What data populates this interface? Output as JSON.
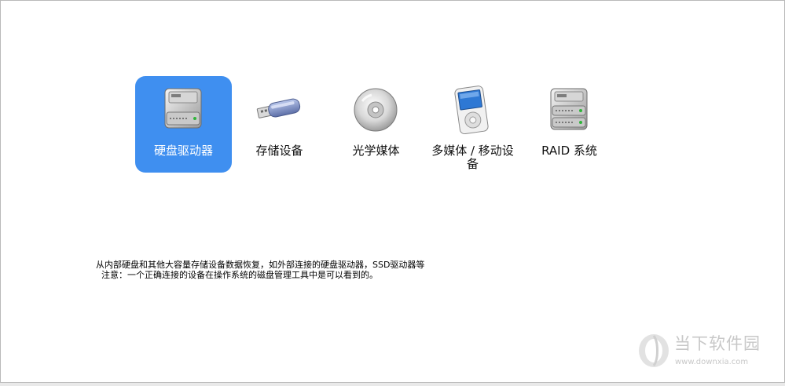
{
  "tiles": [
    {
      "label": "硬盘驱动器",
      "icon": "hard-drive-icon",
      "selected": true
    },
    {
      "label": "存储设备",
      "icon": "usb-drive-icon",
      "selected": false
    },
    {
      "label": "光学媒体",
      "icon": "optical-disc-icon",
      "selected": false
    },
    {
      "label": "多媒体 / 移动设备",
      "icon": "media-player-icon",
      "selected": false
    },
    {
      "label": "RAID 系统",
      "icon": "raid-drive-icon",
      "selected": false
    }
  ],
  "description": {
    "line1": "从内部硬盘和其他大容量存储设备数据恢复，如外部连接的硬盘驱动器，SSD驱动器等",
    "line2": "注意：一个正确连接的设备在操作系统的磁盘管理工具中是可以看到的。"
  },
  "watermark": {
    "text": "当下软件园",
    "url": "www.downxia.com"
  },
  "colors": {
    "selected_tile": "#3f8ff0"
  }
}
